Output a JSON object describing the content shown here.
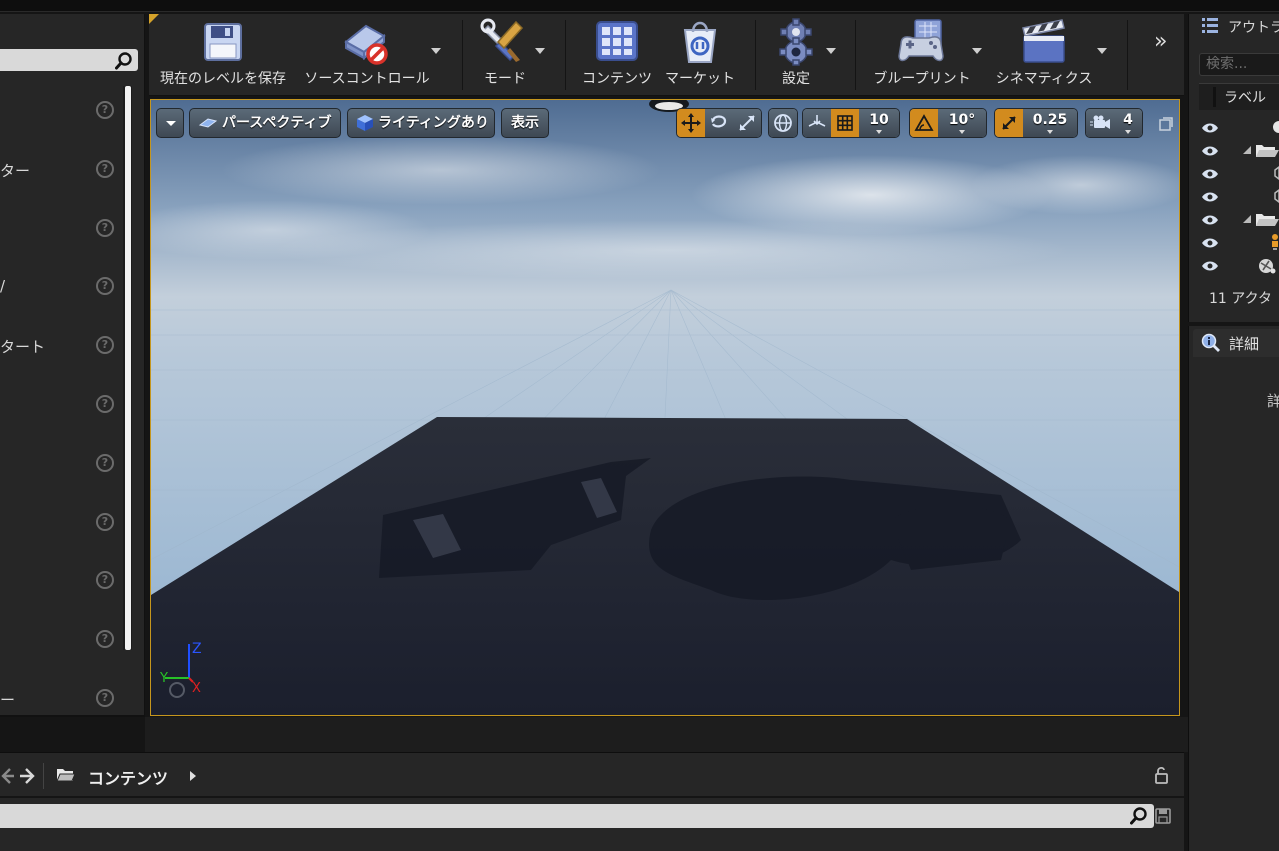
{
  "left_panel": {
    "items": [
      {
        "label": ""
      },
      {
        "label": "ター"
      },
      {
        "label": ""
      },
      {
        "label": "/"
      },
      {
        "label": "タート"
      },
      {
        "label": ""
      },
      {
        "label": ""
      },
      {
        "label": ""
      },
      {
        "label": ""
      },
      {
        "label": ""
      },
      {
        "label": "ー"
      }
    ],
    "help_glyph": "?"
  },
  "toolbar": {
    "save_label": "現在のレベルを保存",
    "source_control_label": "ソースコントロール",
    "modes_label": "モード",
    "content_label": "コンテンツ",
    "marketplace_label": "マーケット",
    "settings_label": "設定",
    "blueprints_label": "ブループリント",
    "cinematics_label": "シネマティクス",
    "more_glyph": "»"
  },
  "viewport": {
    "perspective_label": "パースペクティブ",
    "lighting_label": "ライティングあり",
    "show_label": "表示",
    "grid_snap_value": "10",
    "rotation_snap_value": "10°",
    "scale_snap_value": "0.25",
    "camera_speed_value": "4",
    "axis_labels": {
      "x": "X",
      "y": "Y",
      "z": "Z"
    }
  },
  "content_browser": {
    "title": "コンテンツ"
  },
  "outliner": {
    "tab_label": "アウトラ",
    "search_placeholder": "検索...",
    "column_label": "ラベル",
    "actor_count": "11 アクタ"
  },
  "details": {
    "tab_label": "詳細",
    "empty_text": "詳"
  },
  "colors": {
    "accent": "#d28b1e",
    "viewport_border": "#c5961d",
    "panel_bg": "#262626"
  }
}
